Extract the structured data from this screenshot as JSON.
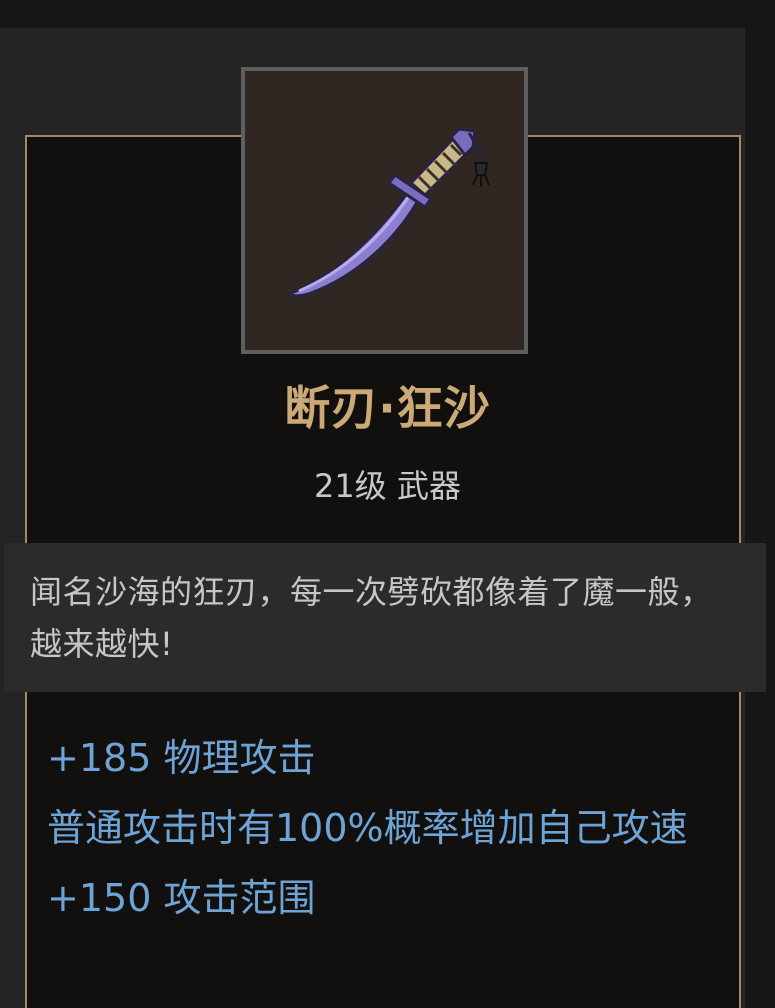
{
  "item": {
    "name": "断刃·狂沙",
    "meta": "21级 武器",
    "icon": "curved-dagger-icon",
    "description": "闻名沙海的狂刃，每一次劈砍都像着了魔一般，越来越快!"
  },
  "stats": [
    "+185 物理攻击",
    "普通攻击时有100%概率增加自己攻速",
    "+150 攻击范围"
  ],
  "colors": {
    "name": "#ccaa78",
    "stat": "#6ea3d6",
    "frame_border": "#a08a63",
    "blade": "#8c7fd0"
  }
}
